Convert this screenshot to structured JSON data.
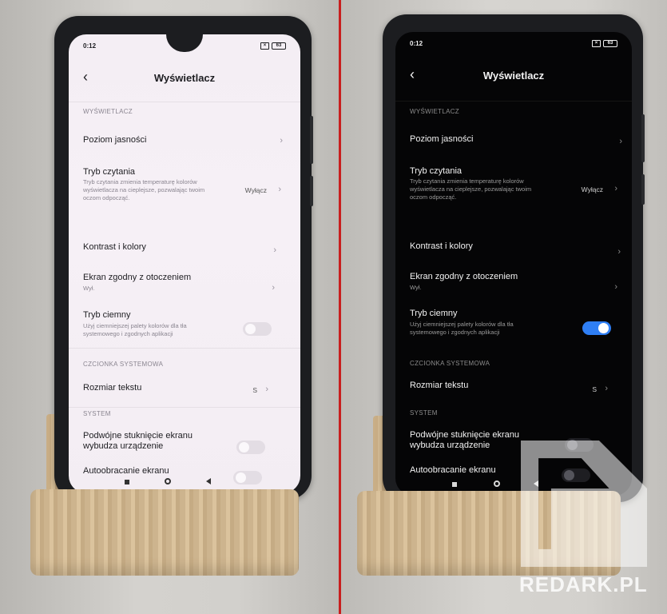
{
  "screen": {
    "status_time": "0:12",
    "battery": "63",
    "title": "Wyświetlacz",
    "section_display": "WYŚWIETLACZ",
    "brightness": "Poziom jasności",
    "reading_mode": "Tryb czytania",
    "reading_mode_desc": "Tryb czytania zmienia temperaturę kolorów wyświetlacza na cieplejsze, pozwalając twoim oczom odpocząć.",
    "reading_mode_value": "Wyłącz",
    "contrast": "Kontrast i kolory",
    "ambient": "Ekran zgodny z otoczeniem",
    "ambient_value": "Wył.",
    "dark_mode": "Tryb ciemny",
    "dark_mode_desc": "Użyj ciemniejszej palety kolorów dla tła systemowego i zgodnych aplikacji",
    "section_font": "CZCIONKA SYSTEMOWA",
    "text_size": "Rozmiar tekstu",
    "text_size_value": "S",
    "section_system": "SYSTEM",
    "double_tap": "Podwójne stuknięcie ekranu wybudza urządzenie",
    "auto_rotate": "Autoobracanie ekranu"
  },
  "toggles": {
    "left_dark_mode_on": false,
    "right_dark_mode_on": true,
    "double_tap_on": false,
    "auto_rotate_on": false
  },
  "colors": {
    "divider": "#c81e1e",
    "toggle_on": "#2f7ff5"
  },
  "watermark": "REDARK.PL"
}
